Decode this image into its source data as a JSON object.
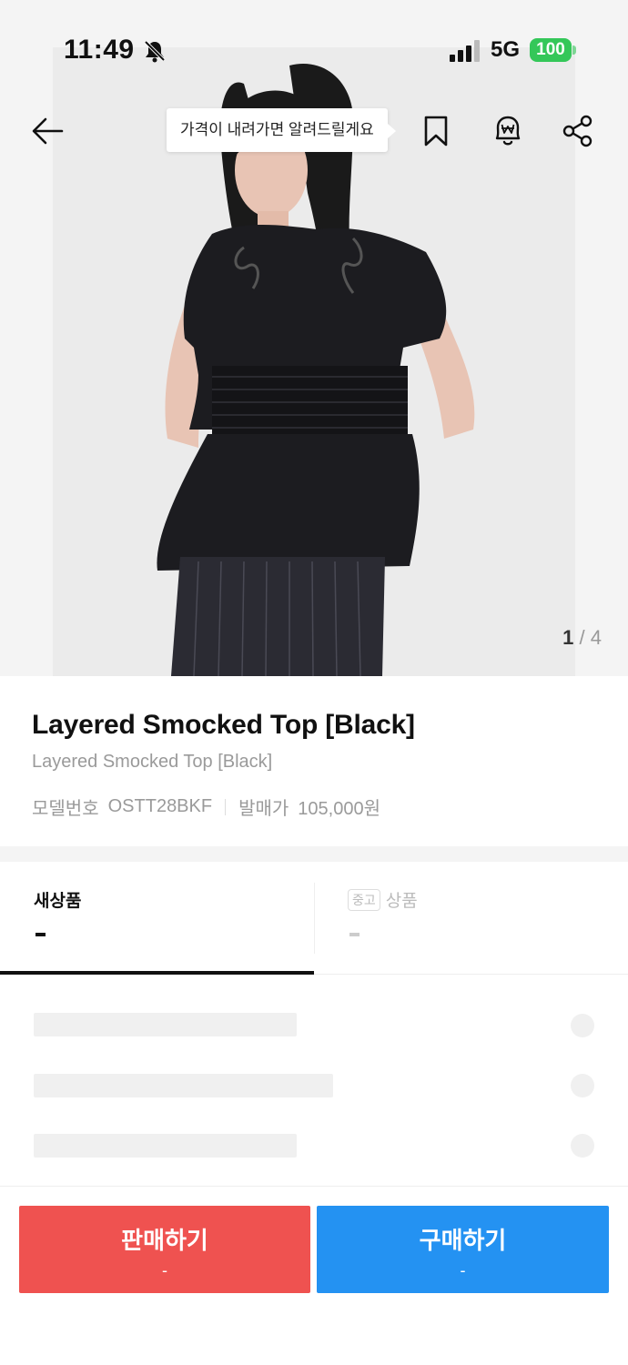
{
  "status_bar": {
    "time": "11:49",
    "network": "5G",
    "battery": "100"
  },
  "header": {
    "tooltip": "가격이 내려가면 알려드릴게요"
  },
  "gallery": {
    "current": "1",
    "separator": "/",
    "total": "4"
  },
  "product": {
    "title": "Layered Smocked Top [Black]",
    "subtitle": "Layered Smocked Top [Black]",
    "model_label": "모델번호",
    "model_value": "OSTT28BKF",
    "release_label": "발매가",
    "release_value": "105,000원"
  },
  "tabs": {
    "new_label": "새상품",
    "new_value": "-",
    "used_badge": "중고",
    "used_label": "상품",
    "used_value": "-"
  },
  "actions": {
    "sell_label": "판매하기",
    "sell_price": "-",
    "buy_label": "구매하기",
    "buy_price": "-"
  },
  "colors": {
    "sell": "#ef5250",
    "buy": "#2492f2",
    "battery": "#34c759"
  },
  "icons": [
    "bell-slash-icon",
    "signal-icon",
    "back-arrow-icon",
    "bookmark-icon",
    "price-alert-icon",
    "share-icon"
  ]
}
